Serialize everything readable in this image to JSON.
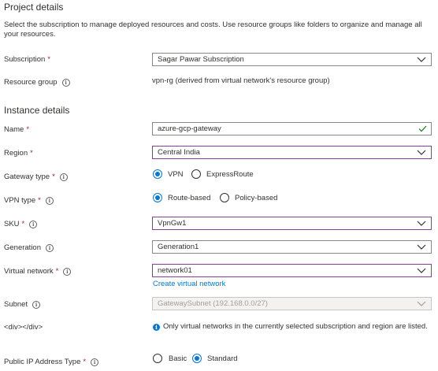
{
  "project_details": {
    "heading": "Project details",
    "description": "Select the subscription to manage deployed resources and costs. Use resource groups like folders to organize and manage all your resources.",
    "subscription_label": "Subscription",
    "subscription_value": "Sagar Pawar Subscription",
    "resource_group_label": "Resource group",
    "resource_group_value": "vpn-rg (derived from virtual network's resource group)"
  },
  "instance_details": {
    "heading": "Instance details",
    "name_label": "Name",
    "name_value": "azure-gcp-gateway",
    "region_label": "Region",
    "region_value": "Central India",
    "gateway_type_label": "Gateway type",
    "gateway_type_options": [
      "VPN",
      "ExpressRoute"
    ],
    "gateway_type_selected": "VPN",
    "vpn_type_label": "VPN type",
    "vpn_type_options": [
      "Route-based",
      "Policy-based"
    ],
    "vpn_type_selected": "Route-based",
    "sku_label": "SKU",
    "sku_value": "VpnGw1",
    "generation_label": "Generation",
    "generation_value": "Generation1",
    "virtual_network_label": "Virtual network",
    "virtual_network_value": "network01",
    "create_vnet_link": "Create virtual network",
    "subnet_label": "Subnet",
    "subnet_value": "GatewaySubnet (192.168.0.0/27)",
    "stray_label": "<div></div>",
    "info_message": "Only virtual networks in the currently selected subscription and region are listed.",
    "public_ip_label": "Public IP Address Type",
    "public_ip_options": [
      "Basic",
      "Standard"
    ],
    "public_ip_selected": "Standard"
  },
  "required_marker": "*",
  "info_glyph": "i",
  "colors": {
    "accent": "#0078d4",
    "focus_border": "#8a3b9e",
    "required": "#a4262c",
    "valid_check": "#107c10"
  },
  "icons": [
    "chevron-down-icon",
    "checkmark-icon",
    "info-icon"
  ]
}
